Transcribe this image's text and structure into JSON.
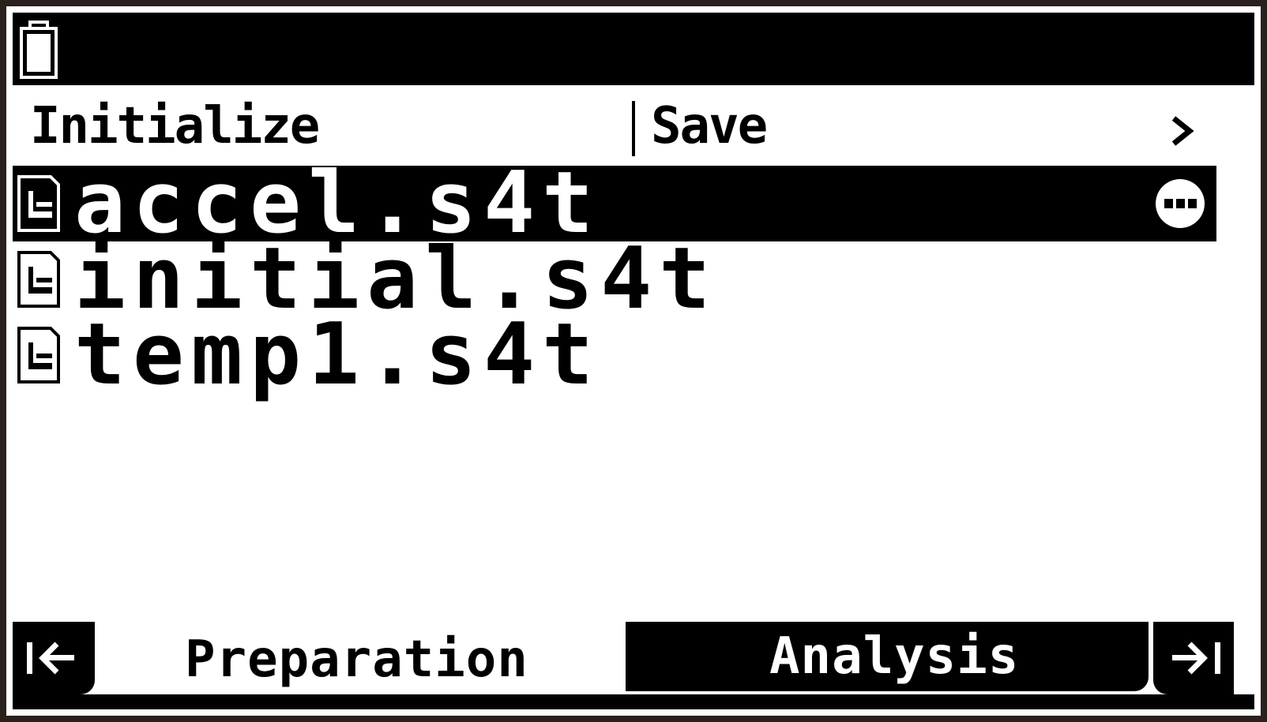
{
  "status_bar": {
    "battery_icon": "battery-icon"
  },
  "menu": {
    "initialize_label": "Initialize",
    "save_label": "Save",
    "more_icon": "chevron-right-icon"
  },
  "files": [
    {
      "name": "accel.s4t",
      "selected": true
    },
    {
      "name": "initial.s4t",
      "selected": false
    },
    {
      "name": "temp1.s4t",
      "selected": false
    }
  ],
  "tabs": {
    "first_icon": "first-page-icon",
    "preparation_label": "Preparation",
    "analysis_label": "Analysis",
    "last_icon": "last-page-icon"
  },
  "colors": {
    "foreground": "#000000",
    "background": "#ffffff",
    "bezel": "#2a211d"
  }
}
